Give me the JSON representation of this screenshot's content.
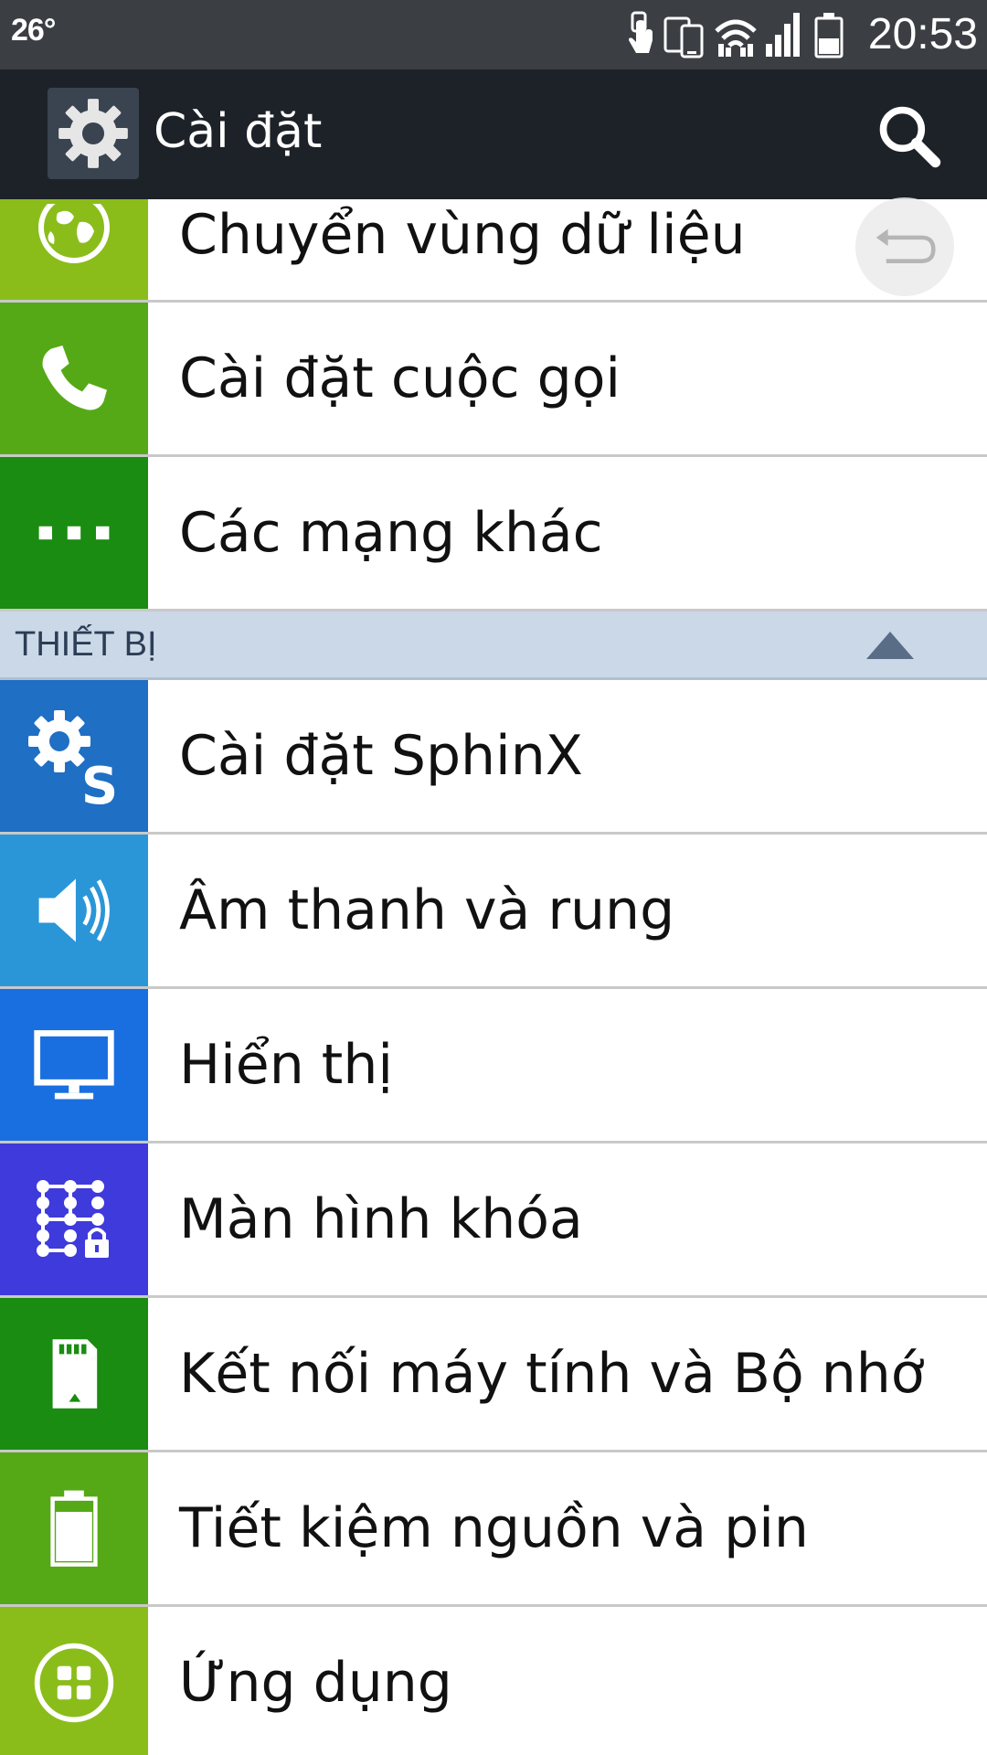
{
  "status_bar": {
    "temperature": "26°",
    "time": "20:53",
    "icons": [
      "touch-icon",
      "dual-screen-icon",
      "wifi-icon",
      "signal-icon",
      "battery-icon"
    ]
  },
  "action_bar": {
    "title": "Cài đặt",
    "icon": "settings-gear-icon",
    "search_icon": "search-icon"
  },
  "colors": {
    "statusbar": "#3b3e43",
    "actionbar": "#1d2228",
    "section_bg": "#cbd8e8",
    "lime": "#8bbd1a",
    "green": "#52a81a",
    "dark_green": "#1a8a1a",
    "blue": "#1f6fc4",
    "sky": "#2a96d8",
    "bright_blue": "#1a6fe0",
    "indigo": "#3f3adb"
  },
  "items_top": [
    {
      "label": "Chuyển vùng dữ liệu",
      "icon": "globe-icon",
      "color": "#8bbd1a"
    },
    {
      "label": "Cài đặt cuộc gọi",
      "icon": "phone-icon",
      "color": "#55a916"
    },
    {
      "label": "Các mạng khác",
      "icon": "more-dots-icon",
      "color": "#1a8c12"
    }
  ],
  "section": {
    "label": "THIẾT BỊ"
  },
  "items_device": [
    {
      "label": "Cài đặt SphinX",
      "icon": "sphinx-settings-icon",
      "color": "#1f6fc4"
    },
    {
      "label": "Âm thanh và rung",
      "icon": "speaker-icon",
      "color": "#2a96d8"
    },
    {
      "label": "Hiển thị",
      "icon": "monitor-icon",
      "color": "#1a6fe0"
    },
    {
      "label": "Màn hình khóa",
      "icon": "pattern-lock-icon",
      "color": "#3f3adb"
    },
    {
      "label": "Kết nối máy tính và Bộ nhớ",
      "icon": "sd-card-icon",
      "color": "#1a8c12"
    },
    {
      "label": "Tiết kiệm nguồn và pin",
      "icon": "battery-saver-icon",
      "color": "#55a916"
    },
    {
      "label": "Ứng dụng",
      "icon": "apps-icon",
      "color": "#8bbd1a"
    }
  ]
}
